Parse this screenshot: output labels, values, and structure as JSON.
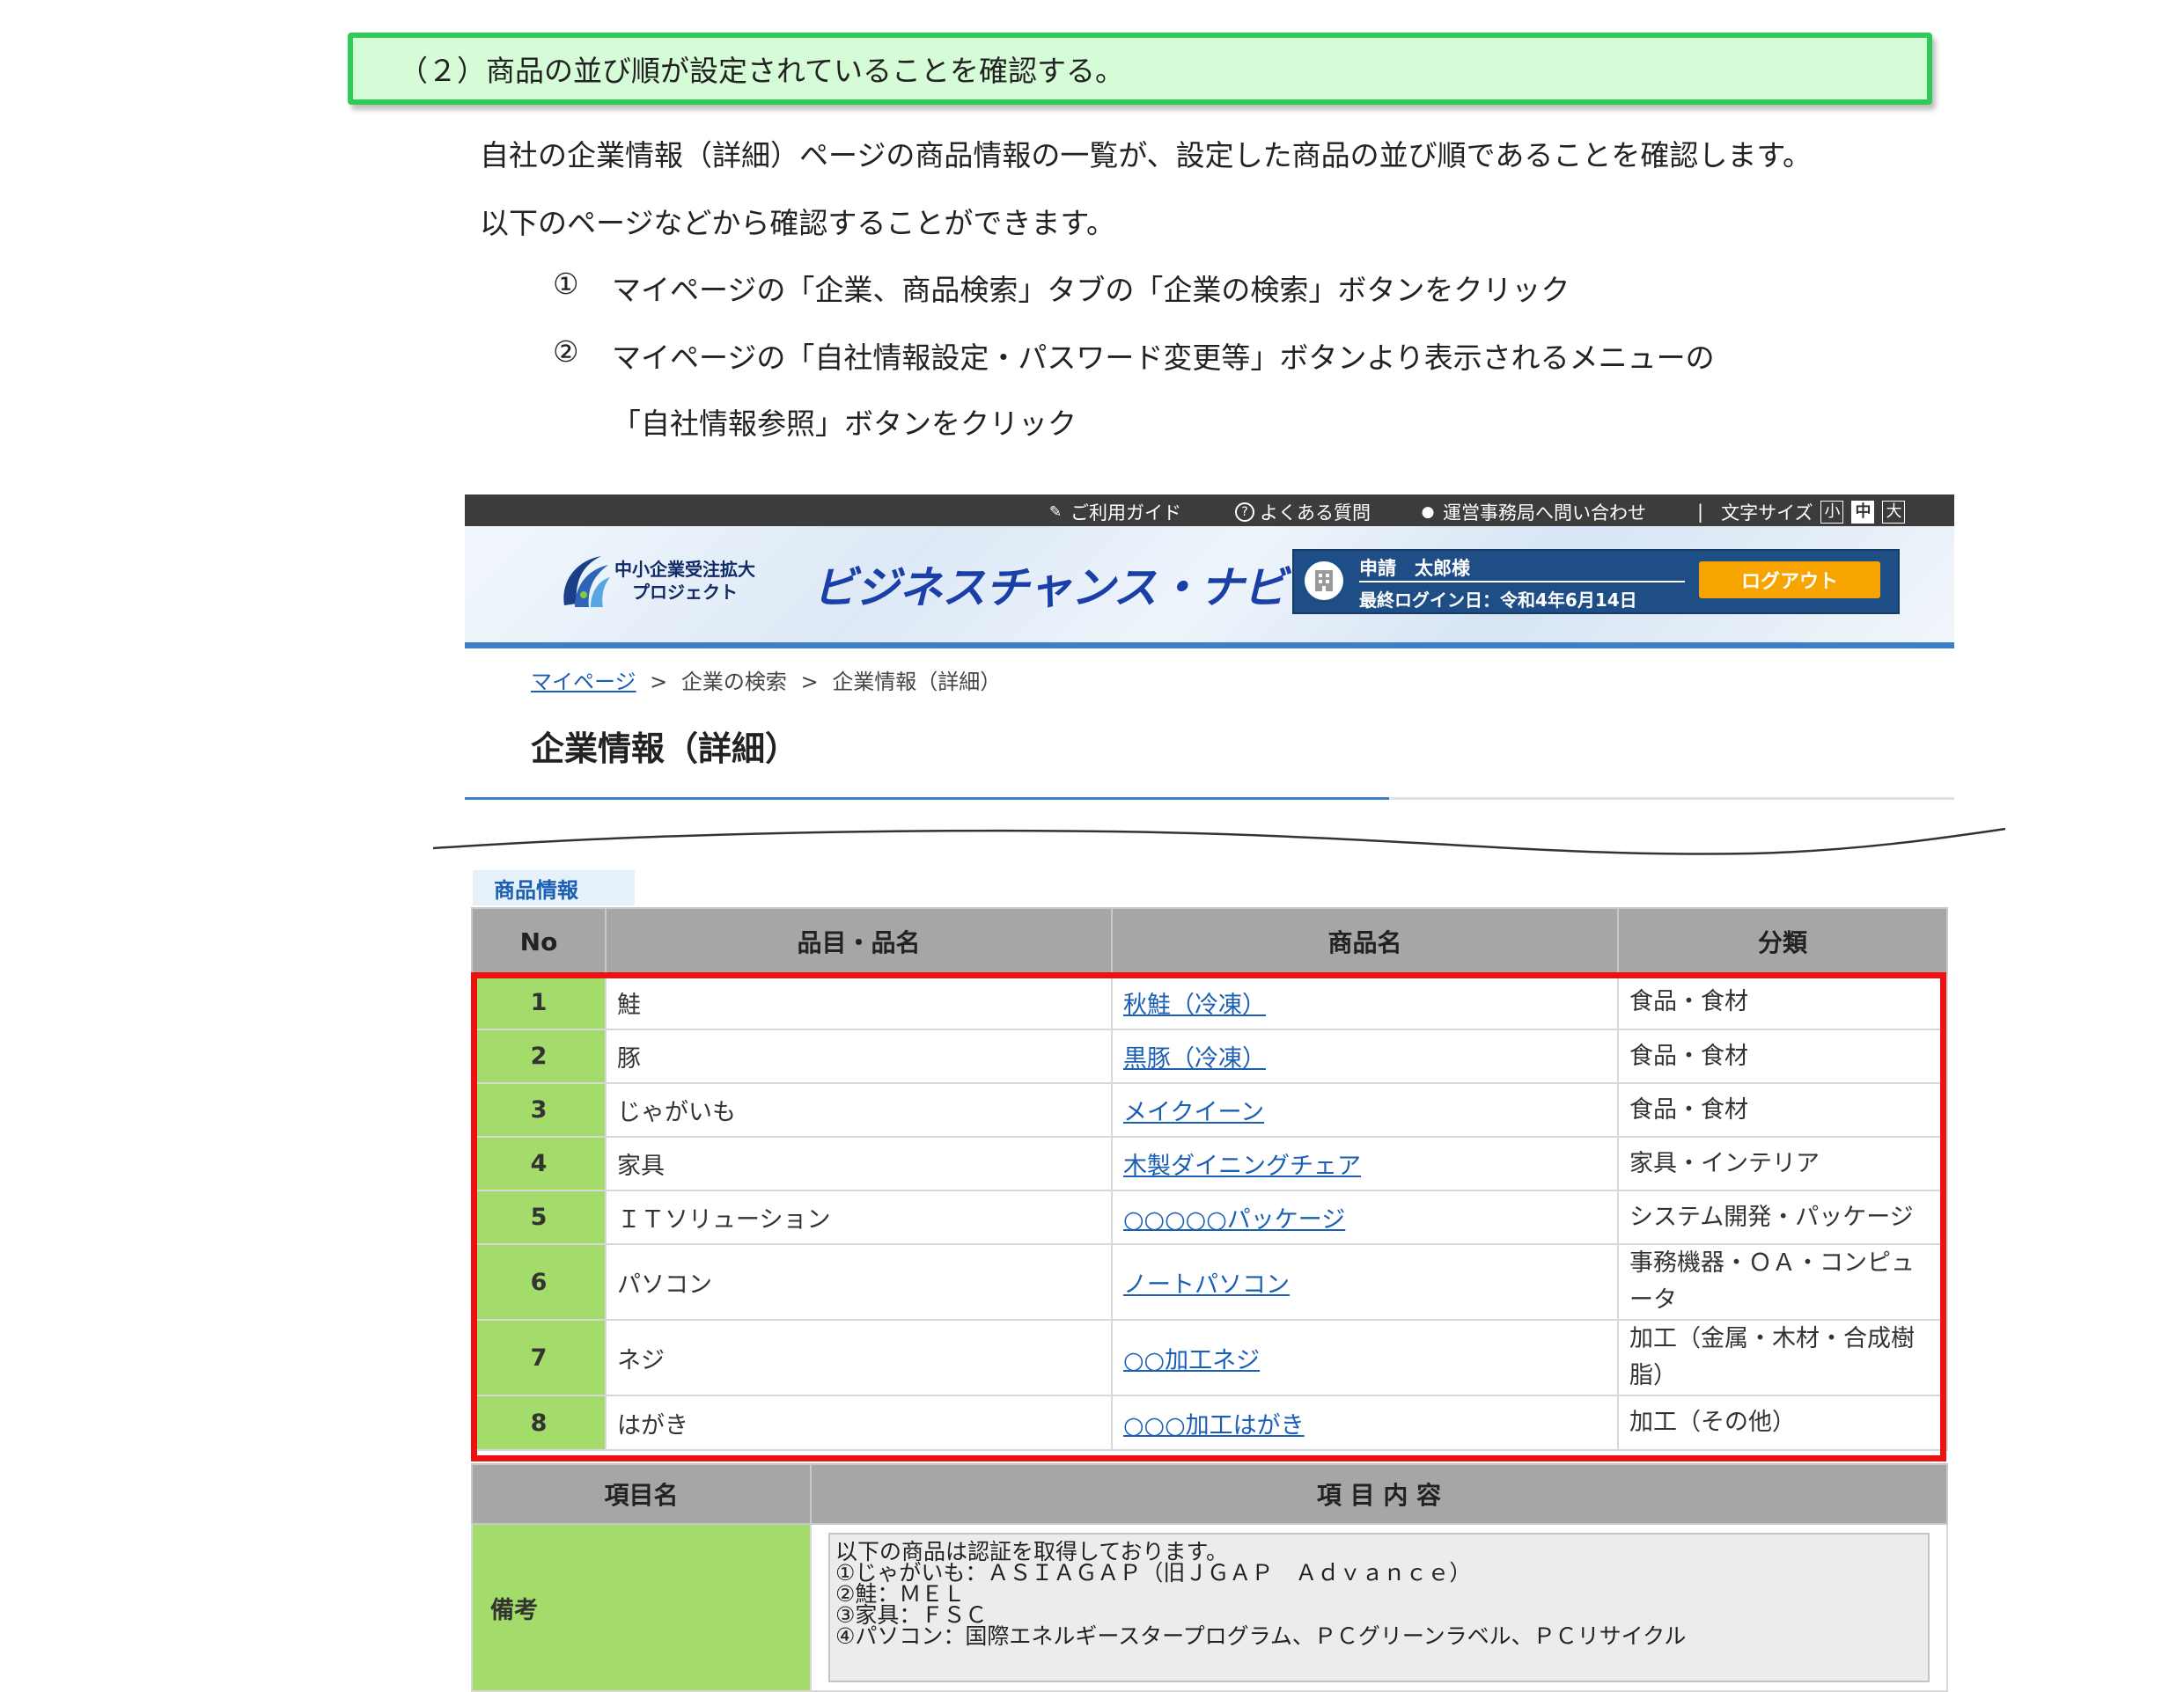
{
  "section_heading": "（２）商品の並び順が設定されていることを確認する。",
  "intro": {
    "line1": "自社の企業情報（詳細）ページの商品情報の一覧が、設定した商品の並び順であることを確認します。",
    "line2": "以下のページなどから確認することができます。"
  },
  "steps": [
    {
      "marker": "①",
      "text": "マイページの「企業、商品検索」タブの「企業の検索」ボタンをクリック"
    },
    {
      "marker": "②",
      "text": "マイページの「自社情報設定・パスワード変更等」ボタンより表示されるメニューの",
      "continuation": "「自社情報参照」ボタンをクリック"
    }
  ],
  "topbar": {
    "guide": "ご利用ガイド",
    "faq": "よくある質問",
    "contact": "運営事務局へ問い合わせ",
    "separator": "|",
    "font_size_label": "文字サイズ",
    "font_sizes": [
      "小",
      "中",
      "大"
    ]
  },
  "header": {
    "logo_line1": "中小企業受注拡大",
    "logo_line2": "プロジェクト",
    "brand": "ビジネスチャンス・ナビ",
    "user_name": "申請　太郎様",
    "last_login": "最終ログイン日：令和4年6月14日",
    "logout_label": "ログアウト"
  },
  "breadcrumb": {
    "home": "マイページ",
    "sep": ">",
    "search": "企業の検索",
    "current": "企業情報（詳細）"
  },
  "page_title": "企業情報（詳細）",
  "products": {
    "tab_label": "商品情報",
    "headers": [
      "No",
      "品目・品名",
      "商品名",
      "分類"
    ],
    "rows": [
      {
        "no": "1",
        "item": "鮭",
        "name": "秋鮭（冷凍）",
        "category": "食品・食材"
      },
      {
        "no": "2",
        "item": "豚",
        "name": "黒豚（冷凍）",
        "category": "食品・食材"
      },
      {
        "no": "3",
        "item": "じゃがいも",
        "name": "メイクイーン",
        "category": "食品・食材"
      },
      {
        "no": "4",
        "item": "家具",
        "name": "木製ダイニングチェア",
        "category": "家具・インテリア"
      },
      {
        "no": "5",
        "item": "ＩＴソリューション",
        "name": "○○○○○パッケージ",
        "category": "システム開発・パッケージ"
      },
      {
        "no": "6",
        "item": "パソコン",
        "name": "ノートパソコン",
        "category": "事務機器・ＯＡ・コンピュータ"
      },
      {
        "no": "7",
        "item": "ネジ",
        "name": "○○加工ネジ",
        "category": "加工（金属・木材・合成樹脂）"
      },
      {
        "no": "8",
        "item": "はがき",
        "name": "○○○加工はがき",
        "category": "加工（その他）"
      }
    ]
  },
  "notes": {
    "headers": [
      "項目名",
      "項 目 内 容"
    ],
    "label": "備考",
    "lines": [
      "以下の商品は認証を取得しております。",
      "①じゃがいも：ＡＳＩＡＧＡＰ（旧ＪＧＡＰ　Ａｄｖａｎｃｅ）",
      "②鮭：ＭＥＬ",
      "③家具：ＦＳＣ",
      "④パソコン：国際エネルギースタープログラム、ＰＣグリーンラベル、ＰＣリサイクル"
    ]
  },
  "colors": {
    "section_bg": "#d6fbd7",
    "section_border": "#2ecb59",
    "header_bar": "#3c3c3c",
    "accent_blue": "#3a7fc8",
    "user_panel": "#1f4e86",
    "logout": "#f7a400",
    "table_header": "#a6a6a6",
    "row_number_bg": "#a3dc6b",
    "highlight_border": "#ee1111",
    "link": "#1a5fb4"
  }
}
